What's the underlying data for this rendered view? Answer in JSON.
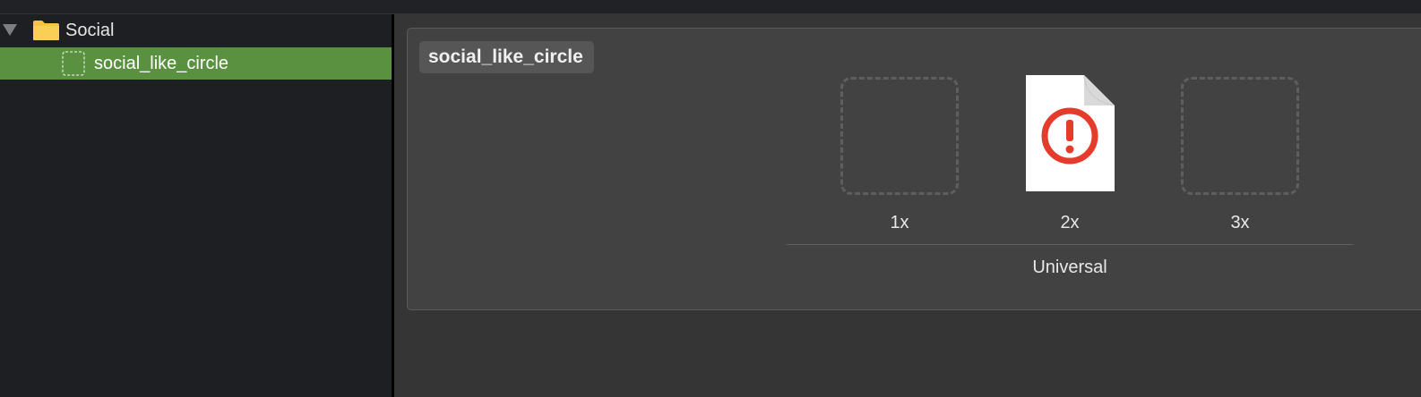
{
  "sidebar": {
    "group": {
      "label": "Social",
      "icon": "folder-icon",
      "expanded": true
    },
    "asset": {
      "label": "social_like_circle",
      "icon": "image-set-icon",
      "selected": true
    }
  },
  "editor": {
    "tab_title": "social_like_circle",
    "slots": [
      {
        "scale": "1x",
        "state": "empty"
      },
      {
        "scale": "2x",
        "state": "missing-file",
        "icon": "warning-document-icon"
      },
      {
        "scale": "3x",
        "state": "empty"
      }
    ],
    "group_label": "Universal"
  },
  "colors": {
    "selection": "#5a9140",
    "folder": "#f6c343",
    "warning": "#e53b2c",
    "panel": "#424242",
    "background": "#353535"
  }
}
